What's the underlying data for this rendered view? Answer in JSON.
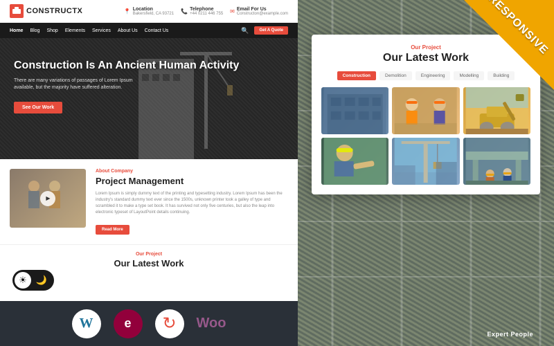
{
  "site": {
    "logo": "CONSTRUCTX",
    "header": {
      "location_label": "Location",
      "location_val": "Bakersfield, CA 93721",
      "telephone_label": "Telephone",
      "telephone_val": "+44 0211 446 755",
      "email_label": "Email For Us",
      "email_val": "Constructon@example.com"
    },
    "nav": {
      "links": [
        "Home",
        "Blog",
        "Shop",
        "Elements",
        "Services",
        "About Us",
        "Contact Us"
      ],
      "cta": "Get A Quote"
    },
    "hero": {
      "title": "Construction Is An Ancient Human Activity",
      "subtitle": "There are many variations of passages of Lorem Ipsum available, but the majority have suffered alteration.",
      "cta": "See Our Work"
    },
    "about": {
      "label": "About Company",
      "title": "Project Management",
      "description": "Lorem Ipsum is simply dummy text of the printing and typesetting industry. Lorem Ipsum has been the industry's standard dummy text ever since the 1500s, unknown printer took a galley of type and scrambled it to make a type set book. It has survived not only five centuries, but also the leap into electronic typeset of LayoutPoint details continuing.",
      "cta": "Read More"
    },
    "latest_work_bottom": {
      "label": "Our Project",
      "title": "Our Latest Work"
    }
  },
  "right_panel": {
    "section_label": "Our Project",
    "title": "Our Latest Work",
    "filter_tabs": [
      "Construction",
      "Demolition",
      "Engineering",
      "Modelling",
      "Building"
    ],
    "active_tab": "Construction",
    "portfolio_items": [
      {
        "id": 1,
        "color": "#5a7a9a"
      },
      {
        "id": 2,
        "color": "#c8a878"
      },
      {
        "id": 3,
        "color": "#d4a540"
      },
      {
        "id": 4,
        "color": "#4a6a5a"
      },
      {
        "id": 5,
        "color": "#7a9aba"
      },
      {
        "id": 6,
        "color": "#5a7a8a"
      }
    ],
    "expert_label": "Expert People"
  },
  "plugins": [
    {
      "name": "WordPress",
      "symbol": "W"
    },
    {
      "name": "Elementor",
      "symbol": "e"
    },
    {
      "name": "Sync",
      "symbol": "↻"
    },
    {
      "name": "WooCommerce",
      "symbol": "Woo"
    }
  ],
  "banner": {
    "text": "RESPONSIVE"
  },
  "toggle": {
    "light": "☀",
    "dark": "🌙"
  }
}
